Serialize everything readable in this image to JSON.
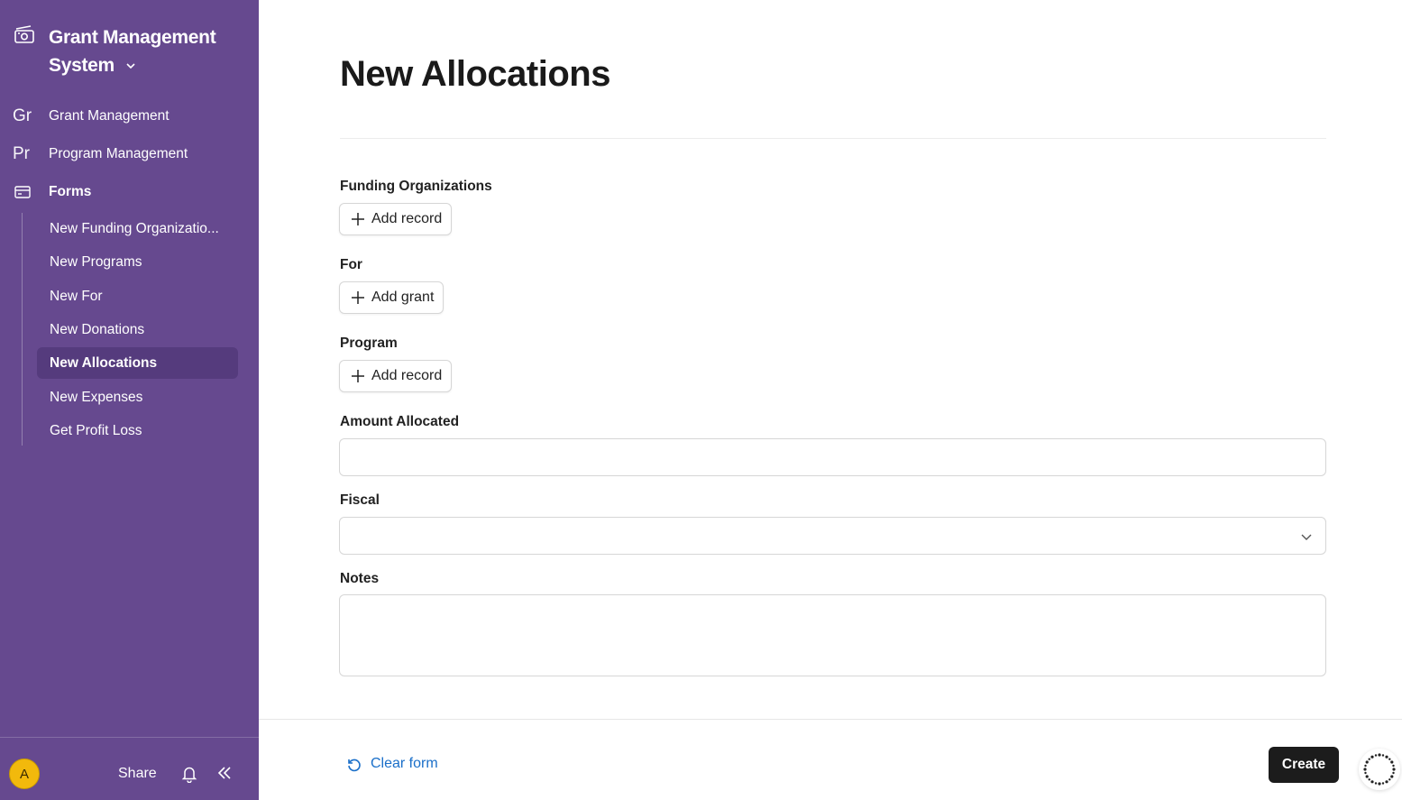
{
  "app": {
    "title_line1": "Grant Management",
    "title_line2": "System",
    "icon": "money-camera-icon"
  },
  "sidebar": {
    "top_items": [
      {
        "abbr": "Gr",
        "label": "Grant Management"
      },
      {
        "abbr": "Pr",
        "label": "Program Management"
      },
      {
        "icon": "window-icon",
        "label": "Forms"
      }
    ],
    "sub_items": [
      {
        "label": "New Funding Organizatio..."
      },
      {
        "label": "New Programs"
      },
      {
        "label": "New For"
      },
      {
        "label": "New Donations"
      },
      {
        "label": "New Allocations",
        "active": true
      },
      {
        "label": "New Expenses"
      },
      {
        "label": "Get Profit Loss"
      }
    ],
    "footer": {
      "avatar_letter": "A",
      "share_label": "Share"
    }
  },
  "page": {
    "title": "New Allocations"
  },
  "form": {
    "funding_organizations": {
      "label": "Funding Organizations",
      "button": "Add record"
    },
    "for": {
      "label": "For",
      "button": "Add grant"
    },
    "program": {
      "label": "Program",
      "button": "Add record"
    },
    "amount_allocated": {
      "label": "Amount Allocated",
      "value": ""
    },
    "fiscal": {
      "label": "Fiscal",
      "value": ""
    },
    "notes": {
      "label": "Notes",
      "value": ""
    }
  },
  "footer": {
    "clear_label": "Clear form",
    "create_label": "Create"
  },
  "colors": {
    "sidebar_bg": "#66498f",
    "sidebar_active": "#553b7d",
    "link_blue": "#1a6fc9",
    "primary_button": "#1c1c1c",
    "avatar": "#f2b90c"
  }
}
